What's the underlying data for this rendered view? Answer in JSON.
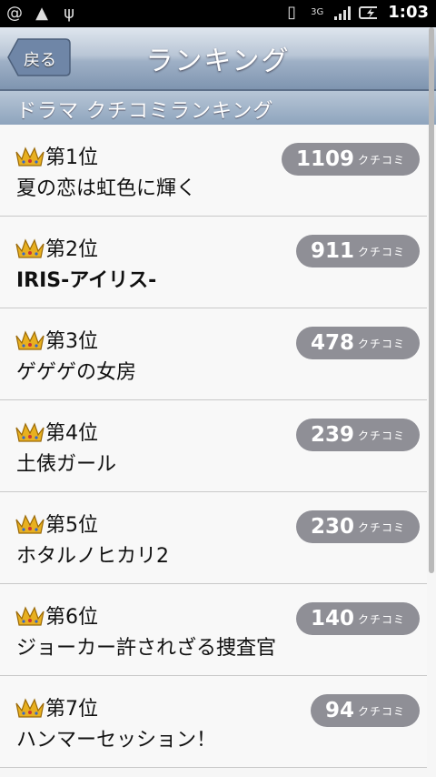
{
  "status": {
    "time": "1:03"
  },
  "header": {
    "back_label": "戻る",
    "title": "ランキング"
  },
  "section": {
    "label": "ドラマ クチコミランキング"
  },
  "items": [
    {
      "rank": "第1位",
      "count": "1109",
      "unit": "クチコミ",
      "title": "夏の恋は虹色に輝く"
    },
    {
      "rank": "第2位",
      "count": "911",
      "unit": "クチコミ",
      "title": "IRIS-アイリス-"
    },
    {
      "rank": "第3位",
      "count": "478",
      "unit": "クチコミ",
      "title": "ゲゲゲの女房"
    },
    {
      "rank": "第4位",
      "count": "239",
      "unit": "クチコミ",
      "title": "土俵ガール"
    },
    {
      "rank": "第5位",
      "count": "230",
      "unit": "クチコミ",
      "title": "ホタルノヒカリ2"
    },
    {
      "rank": "第6位",
      "count": "140",
      "unit": "クチコミ",
      "title": "ジョーカー許されざる捜査官"
    },
    {
      "rank": "第7位",
      "count": "94",
      "unit": "クチコミ",
      "title": "ハンマーセッション！"
    }
  ]
}
